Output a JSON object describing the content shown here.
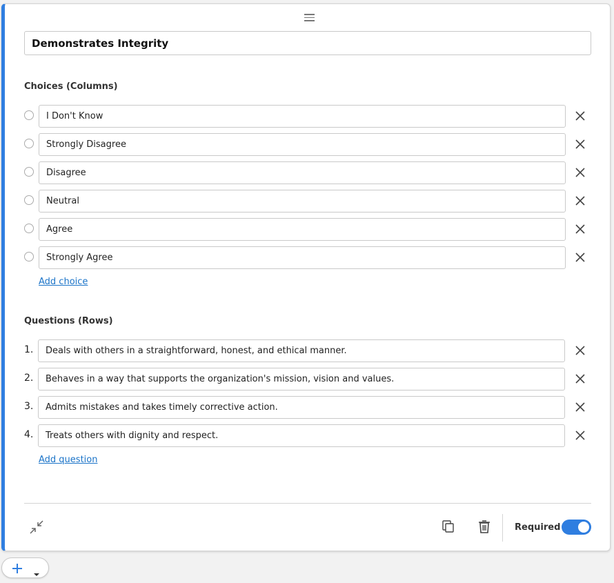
{
  "question": {
    "title": "Demonstrates Integrity"
  },
  "choices": {
    "label": "Choices (Columns)",
    "items": [
      "I Don't Know",
      "Strongly Disagree",
      "Disagree",
      "Neutral",
      "Agree",
      "Strongly Agree"
    ],
    "add_label": "Add choice"
  },
  "rows": {
    "label": "Questions (Rows)",
    "items": [
      {
        "num": "1.",
        "text": "Deals with others in a straightforward, honest, and ethical manner."
      },
      {
        "num": "2.",
        "text": "Behaves in a way that supports the organization's mission, vision and values."
      },
      {
        "num": "3.",
        "text": "Admits mistakes and takes timely corrective action."
      },
      {
        "num": "4.",
        "text": "Treats others with dignity and respect."
      }
    ],
    "add_label": "Add question"
  },
  "footer": {
    "required_label": "Required",
    "required_on": true
  },
  "icons": {
    "drag": "drag-handle-icon",
    "remove": "close-icon",
    "collapse": "collapse-icon",
    "copy": "copy-icon",
    "delete": "trash-icon",
    "add": "plus-icon",
    "dropdown": "caret-down-icon"
  },
  "colors": {
    "accent": "#2f7ee0",
    "link": "#1a73c8"
  }
}
